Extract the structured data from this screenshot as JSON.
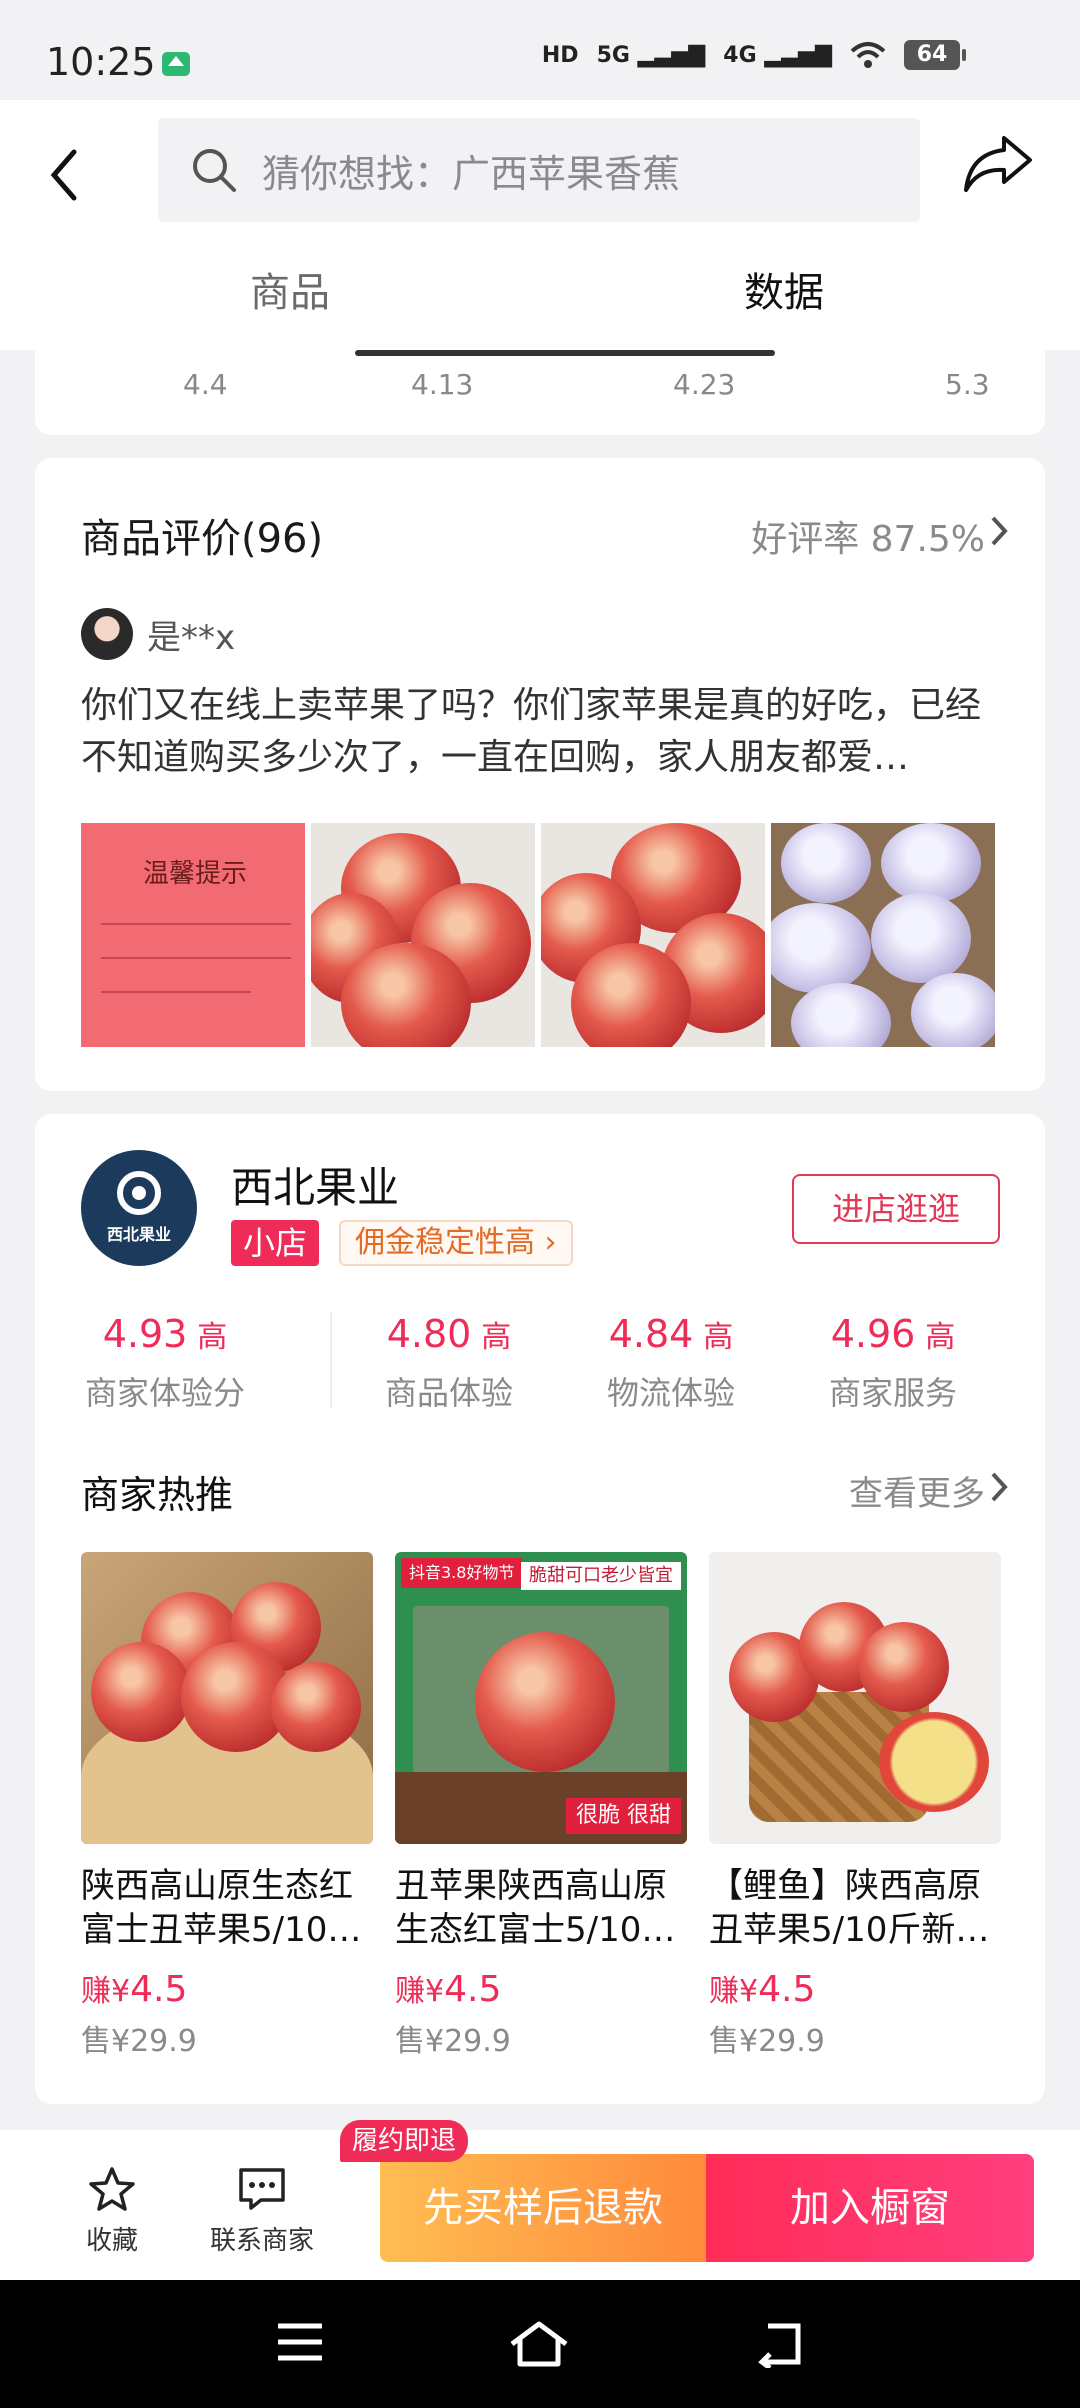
{
  "status_bar": {
    "time": "10:25",
    "network_hd": "HD",
    "network_5g": "5G",
    "network_4g": "4G",
    "battery": "64"
  },
  "header": {
    "search_placeholder": "猜你想找：广西苹果香蕉",
    "tabs": [
      {
        "label": "商品",
        "active": false
      },
      {
        "label": "数据",
        "active": true
      }
    ]
  },
  "chart_tail": {
    "x_ticks": [
      "4.4",
      "4.13",
      "4.23",
      "5.3"
    ]
  },
  "reviews": {
    "title": "商品评价(96)",
    "good_rate": "好评率 87.5%",
    "user": "是**x",
    "text": "你们又在线上卖苹果了吗？你们家苹果是真的好吃，已经不知道购买多少次了，一直在回购，家人朋友都爱…",
    "photo_note_title": "温馨提示",
    "photos": [
      "notice-photo",
      "apples-photo",
      "apples-photo",
      "boxed-apples-photo"
    ]
  },
  "shop": {
    "name": "西北果业",
    "logo_text": "西北果业",
    "badge": "小店",
    "tag": "佣金稳定性高",
    "visit_button": "进店逛逛",
    "metrics": [
      {
        "score": "4.93",
        "level": "高",
        "label": "商家体验分"
      },
      {
        "score": "4.80",
        "level": "高",
        "label": "商品体验"
      },
      {
        "score": "4.84",
        "level": "高",
        "label": "物流体验"
      },
      {
        "score": "4.96",
        "level": "高",
        "label": "商家服务"
      }
    ],
    "hot_title": "商家热推",
    "hot_more": "查看更多",
    "products": [
      {
        "name": "陕西高山原生态红富士丑苹果5/10…",
        "earn_prefix": "赚¥",
        "earn": "4.5",
        "sale": "售¥29.9"
      },
      {
        "name": "丑苹果陕西高山原生态红富士5/10…",
        "earn_prefix": "赚¥",
        "earn": "4.5",
        "sale": "售¥29.9",
        "img_banner": "抖音3.8好物节",
        "img_slogan": "脆甜可口老少皆宜",
        "img_tag": "很脆 很甜"
      },
      {
        "name": "【鲤鱼】陕西高原丑苹果5/10斤新…",
        "earn_prefix": "赚¥",
        "earn": "4.5",
        "sale": "售¥29.9"
      }
    ]
  },
  "bottom_bar": {
    "favorite": "收藏",
    "contact": "联系商家",
    "badge": "履约即退",
    "cta_left": "先买样后退款",
    "cta_right": "加入橱窗"
  },
  "colors": {
    "accent": "#ef2b57",
    "cta_orange": "#ff8a3c",
    "shop_tag": "#e36b24"
  }
}
